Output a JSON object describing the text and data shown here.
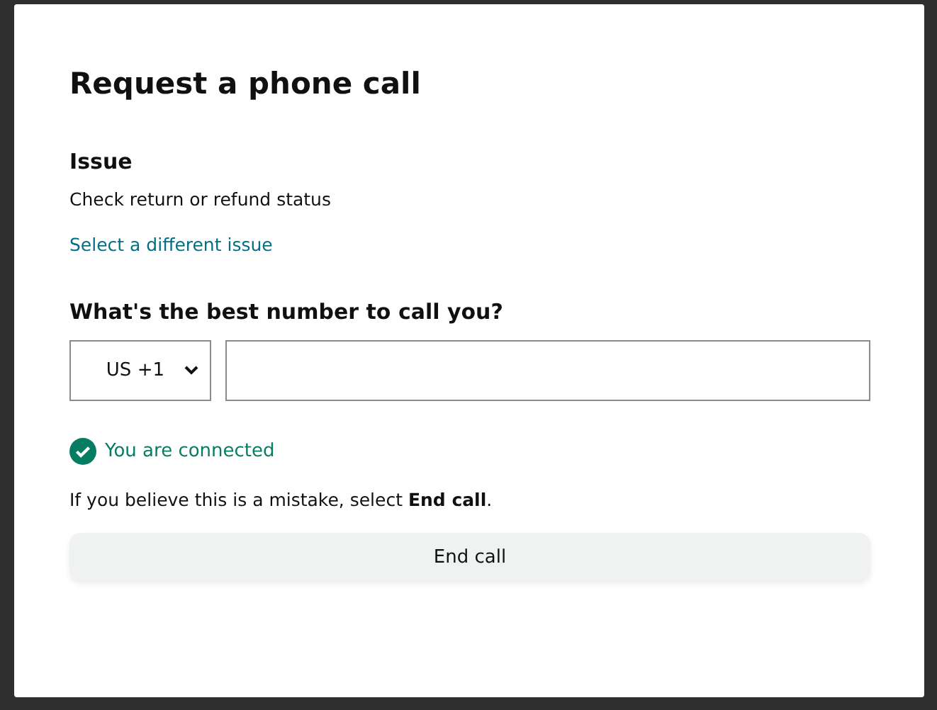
{
  "dialog": {
    "title": "Request a phone call",
    "issue": {
      "heading": "Issue",
      "value": "Check return or refund status",
      "link": "Select a different issue"
    },
    "phone": {
      "label": "What's the best number to call you?",
      "country_code": "US +1"
    },
    "status": {
      "text": "You are connected",
      "connected": true
    },
    "note": "If you believe this is a mistake, select **End call**.",
    "button": "End call"
  }
}
